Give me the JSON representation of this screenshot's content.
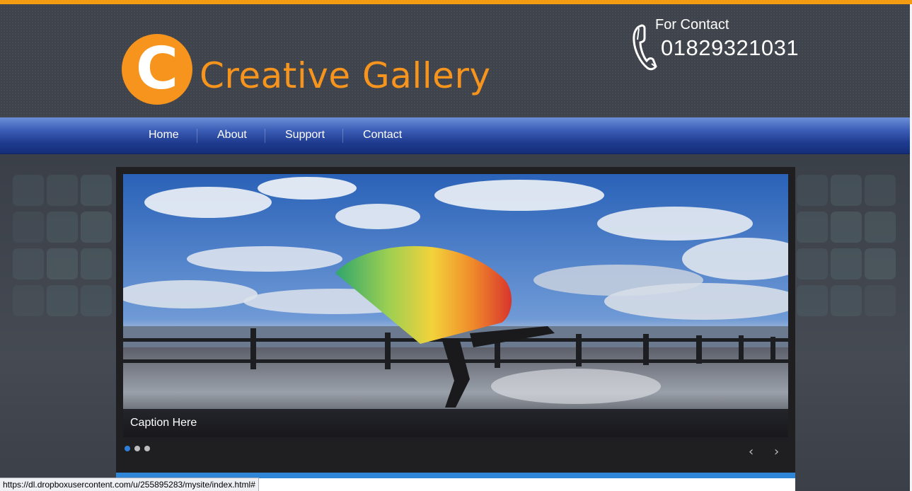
{
  "site": {
    "logo_letter": "C",
    "title": "Creative Gallery"
  },
  "contact": {
    "label": "For Contact",
    "phone": "01829321031",
    "icon": "phone-icon"
  },
  "nav": {
    "items": [
      {
        "label": "Home"
      },
      {
        "label": "About"
      },
      {
        "label": "Support"
      },
      {
        "label": "Contact"
      }
    ]
  },
  "slider": {
    "caption": "Caption Here",
    "slide_count": 3,
    "active_index": 0,
    "prev_glyph": "‹",
    "next_glyph": "›"
  },
  "statusbar": {
    "url": "https://dl.dropboxusercontent.com/u/255895283/mysite/index.html#"
  },
  "colors": {
    "accent_orange": "#f7941d",
    "nav_blue": "#1e3b8f",
    "active_dot": "#2f7fd9"
  }
}
